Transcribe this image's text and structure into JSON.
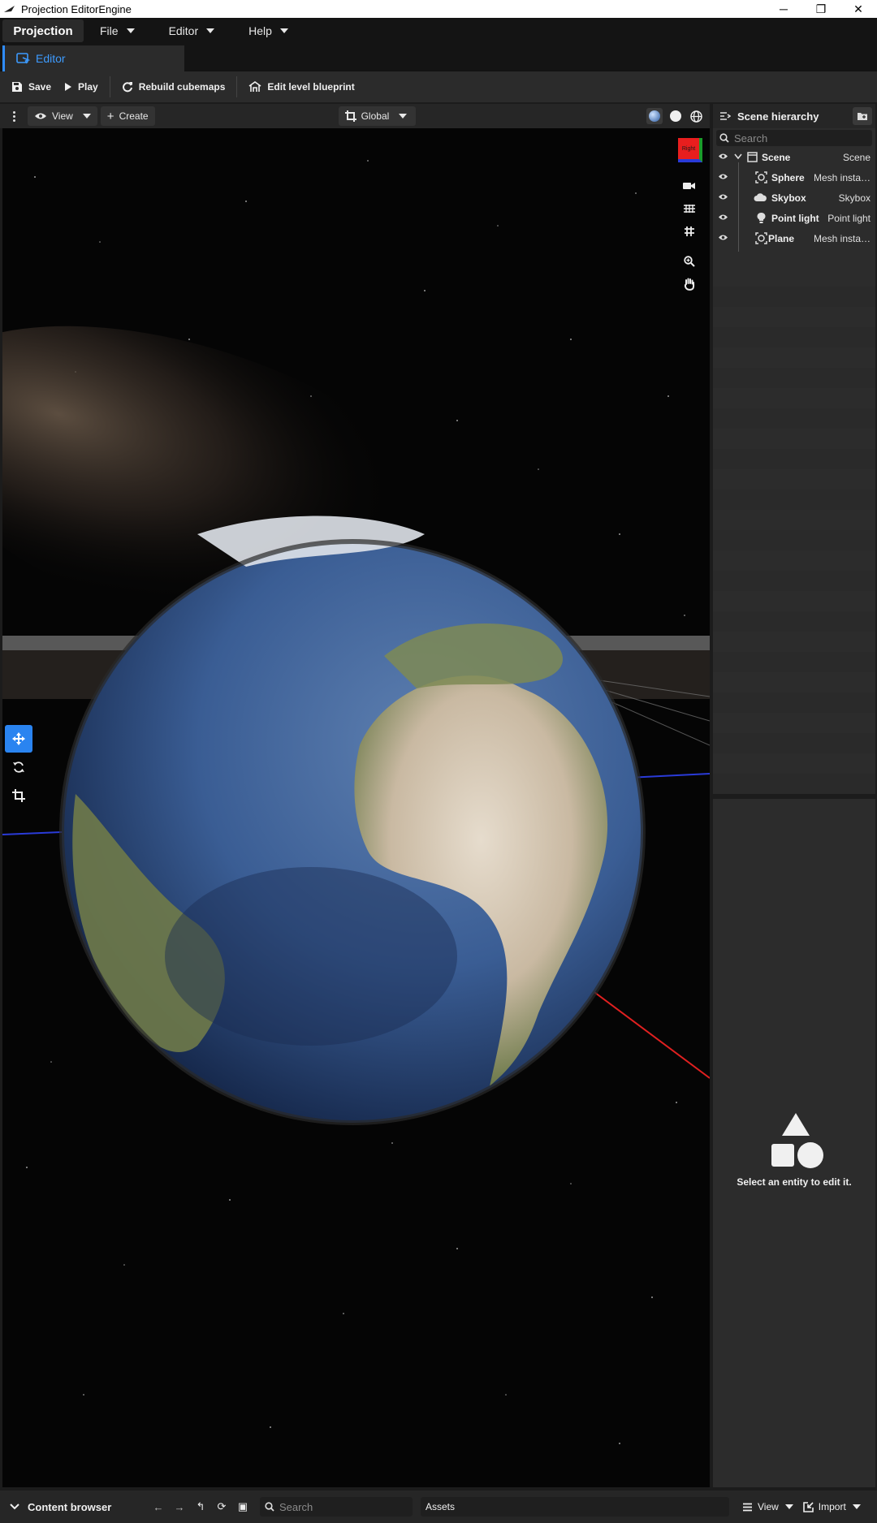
{
  "window": {
    "title": "Projection EditorEngine",
    "minimize_glyph": "─",
    "maximize_glyph": "❐",
    "close_glyph": "✕"
  },
  "menubar": {
    "brand": "Projection",
    "items": [
      {
        "label": "File"
      },
      {
        "label": "Editor"
      },
      {
        "label": "Help"
      }
    ]
  },
  "tabs": [
    {
      "label": "Editor",
      "active": true
    }
  ],
  "toolbar": {
    "save": "Save",
    "play": "Play",
    "rebuild": "Rebuild cubemaps",
    "blueprint": "Edit level blueprint"
  },
  "viewport_bar": {
    "view": "View",
    "create": "Create",
    "transform_space": "Global"
  },
  "viewport": {
    "gizmo_label": "Right",
    "colors": {
      "x_axis": "#e02020",
      "z_axis": "#2a3bd8",
      "accent": "#2a84f0"
    }
  },
  "hierarchy": {
    "title": "Scene hierarchy",
    "search_placeholder": "Search",
    "rows": [
      {
        "name": "Scene",
        "type": "Scene",
        "icon": "scene-icon"
      },
      {
        "name": "Sphere",
        "type": "Mesh insta…",
        "icon": "mesh-icon"
      },
      {
        "name": "Skybox",
        "type": "Skybox",
        "icon": "cloud-icon"
      },
      {
        "name": "Point light",
        "type": "Point light",
        "icon": "bulb-icon"
      },
      {
        "name": "Plane",
        "type": "Mesh insta…",
        "icon": "mesh-icon"
      }
    ]
  },
  "inspector": {
    "empty_message": "Select an entity to edit it."
  },
  "content_browser": {
    "title": "Content browser",
    "search_placeholder": "Search",
    "path": "Assets",
    "view": "View",
    "import": "Import"
  }
}
